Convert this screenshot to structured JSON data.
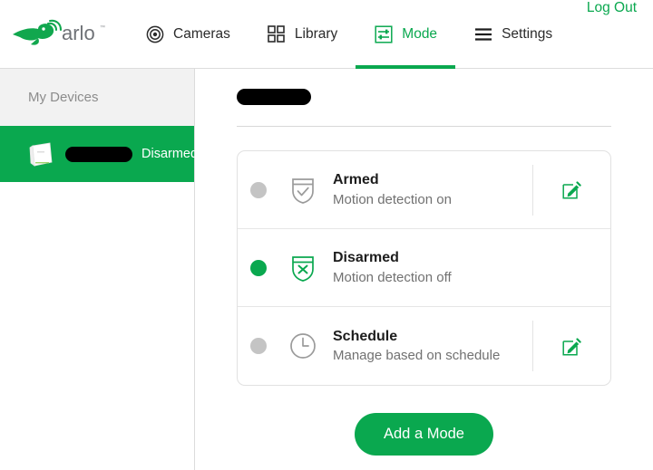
{
  "brand": {
    "logo_text": "arlo",
    "logo_icon": "arlo-bird-logo",
    "accent_color": "#0aa84f",
    "gray_color": "#c4c4c4"
  },
  "topnav": {
    "items": [
      {
        "label": "Cameras",
        "icon": "camera-lens-icon",
        "active": false
      },
      {
        "label": "Library",
        "icon": "grid-icon",
        "active": false
      },
      {
        "label": "Mode",
        "icon": "sliders-icon",
        "active": true
      },
      {
        "label": "Settings",
        "icon": "hamburger-icon",
        "active": false
      }
    ],
    "logout_label": "Log Out"
  },
  "sidebar": {
    "header": "My Devices",
    "device": {
      "icon": "base-station-icon",
      "name": "",
      "name_redacted": true,
      "status": "Disarmed",
      "selected": true
    }
  },
  "main": {
    "page_title": "",
    "page_title_redacted": true,
    "modes": [
      {
        "title": "Armed",
        "subtitle": "Motion detection on",
        "icon": "shield-check-icon",
        "selected": false,
        "editable": true,
        "edit_icon": "pencil-edit-icon"
      },
      {
        "title": "Disarmed",
        "subtitle": "Motion detection off",
        "icon": "shield-x-icon",
        "selected": true,
        "editable": false,
        "edit_icon": ""
      },
      {
        "title": "Schedule",
        "subtitle": "Manage based on schedule",
        "icon": "clock-icon",
        "selected": false,
        "editable": true,
        "edit_icon": "pencil-edit-icon"
      }
    ],
    "add_mode_label": "Add a Mode"
  }
}
